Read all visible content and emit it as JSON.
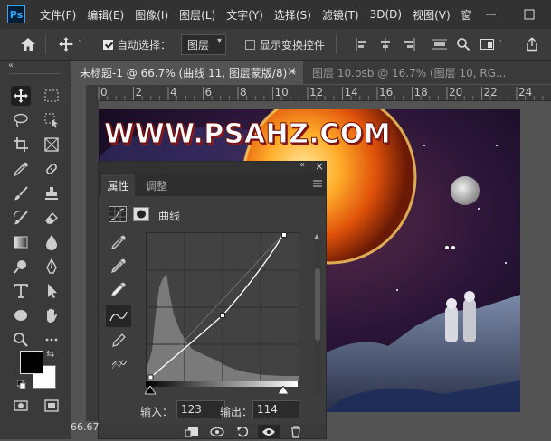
{
  "menubar": {
    "logo": "Ps",
    "items": [
      "文件(F)",
      "编辑(E)",
      "图像(I)",
      "图层(L)",
      "文字(Y)",
      "选择(S)",
      "滤镜(T)",
      "3D(D)",
      "视图(V)",
      "窗"
    ],
    "window_controls": [
      "minimize-icon",
      "maximize-icon"
    ]
  },
  "options": {
    "auto_select_label": "自动选择：",
    "auto_select_checked": true,
    "auto_select_target": "图层",
    "show_transform_label": "显示变换控件",
    "show_transform_checked": false
  },
  "tabs": [
    {
      "label": "未标题-1 @ 66.7% (曲线 11, 图层蒙版/8) *",
      "active": true,
      "close": "×"
    },
    {
      "label": "图层 10.psb @ 16.7% (图层 10, RG...",
      "active": false
    }
  ],
  "ruler": {
    "ticks": [
      "0",
      "2",
      "4",
      "6",
      "8",
      "10",
      "12",
      "14",
      "16",
      "18",
      "20",
      "22",
      "24"
    ]
  },
  "canvas": {
    "watermark": "WWW.PSAHZ.COM"
  },
  "panel": {
    "tab_properties": "属性",
    "tab_adjustments": "调整",
    "curves_label": "曲线",
    "input_label": "输入：",
    "input_value": "123",
    "output_label": "输出：",
    "output_value": "114"
  },
  "status": {
    "zoom": "66.67"
  }
}
